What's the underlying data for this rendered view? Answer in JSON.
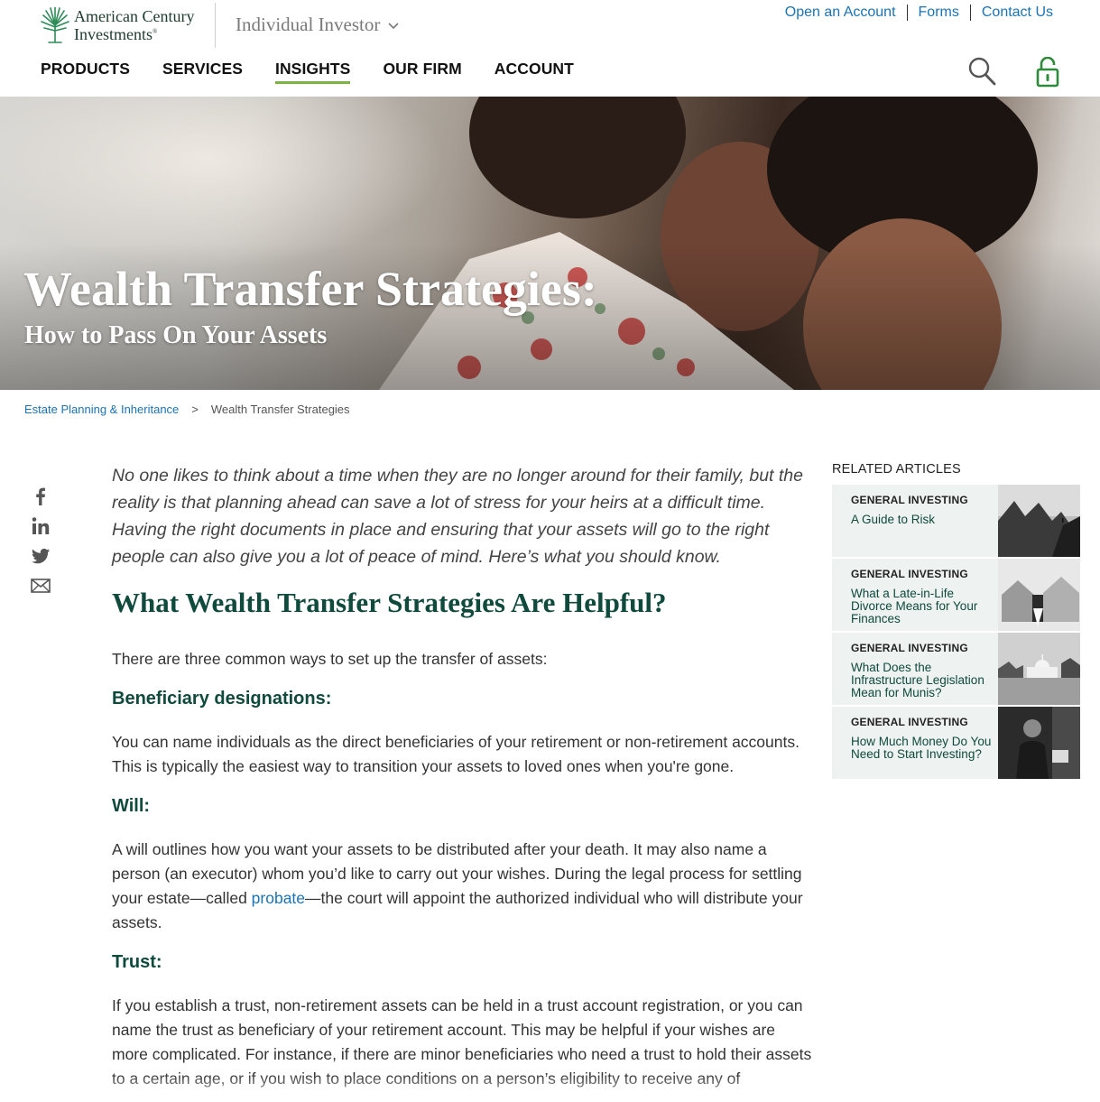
{
  "header": {
    "logo_line1": "American Century",
    "logo_line2": "Investments",
    "logo_mark": "®",
    "audience": "Individual Investor",
    "util_links": [
      "Open an Account",
      "Forms",
      "Contact Us"
    ],
    "nav": [
      "PRODUCTS",
      "SERVICES",
      "INSIGHTS",
      "OUR FIRM",
      "ACCOUNT"
    ],
    "active_nav": "INSIGHTS",
    "accent": "#7cb342",
    "link_color": "#1a73b5",
    "brand_green": "#0f4a3c"
  },
  "hero": {
    "title": "Wealth Transfer Strategies:",
    "subtitle": "How to Pass On Your Assets"
  },
  "breadcrumb": {
    "parent": "Estate Planning & Inheritance",
    "separator": ">",
    "current": "Wealth Transfer Strategies"
  },
  "social": [
    "facebook-icon",
    "linkedin-icon",
    "twitter-icon",
    "email-icon"
  ],
  "article": {
    "intro": "No one likes to think about a time when they are no longer around for their family, but the reality is that planning ahead can save a lot of stress for your heirs at a difficult time. Having the right documents in place and ensuring that your assets will go to the right people can also give you a lot of peace of mind. Here’s what you should know.",
    "h2": "What Wealth Transfer Strategies Are Helpful?",
    "lead": "There are three common ways to set up the transfer of assets:",
    "beneficiary_heading": "Beneficiary designations:",
    "beneficiary_text": "You can name individuals as the direct beneficiaries of your retirement or non-retirement accounts. This is typically the easiest way to transition your assets to loved ones when you're gone.",
    "will_heading": "Will:",
    "will_text_before": "A will outlines how you want your assets to be distributed after your death. It may also name a person (an executor) whom you’d like to carry out your wishes. During the legal process for settling your estate—called ",
    "will_link": "probate",
    "will_text_after": "—the court will appoint the authorized individual who will distribute your assets.",
    "trust_heading": "Trust:",
    "trust_text": "If you establish a trust, non-retirement assets can be held in a trust account registration, or you can name the trust as beneficiary of your retirement account. This may be helpful if your wishes are more complicated. For instance, if there are minor beneficiaries who need a trust to hold their assets to a certain age, or if you wish to place conditions on a person’s eligibility to receive any of"
  },
  "related": {
    "title": "RELATED ARTICLES",
    "items": [
      {
        "category": "GENERAL INVESTING",
        "title": "A Guide to Risk"
      },
      {
        "category": "GENERAL INVESTING",
        "title": "What a Late-in-Life Divorce Means for Your Finances"
      },
      {
        "category": "GENERAL INVESTING",
        "title": "What Does the Infrastructure Legislation Mean for Munis?"
      },
      {
        "category": "GENERAL INVESTING",
        "title": "How Much Money Do You Need to Start Investing?"
      }
    ]
  }
}
